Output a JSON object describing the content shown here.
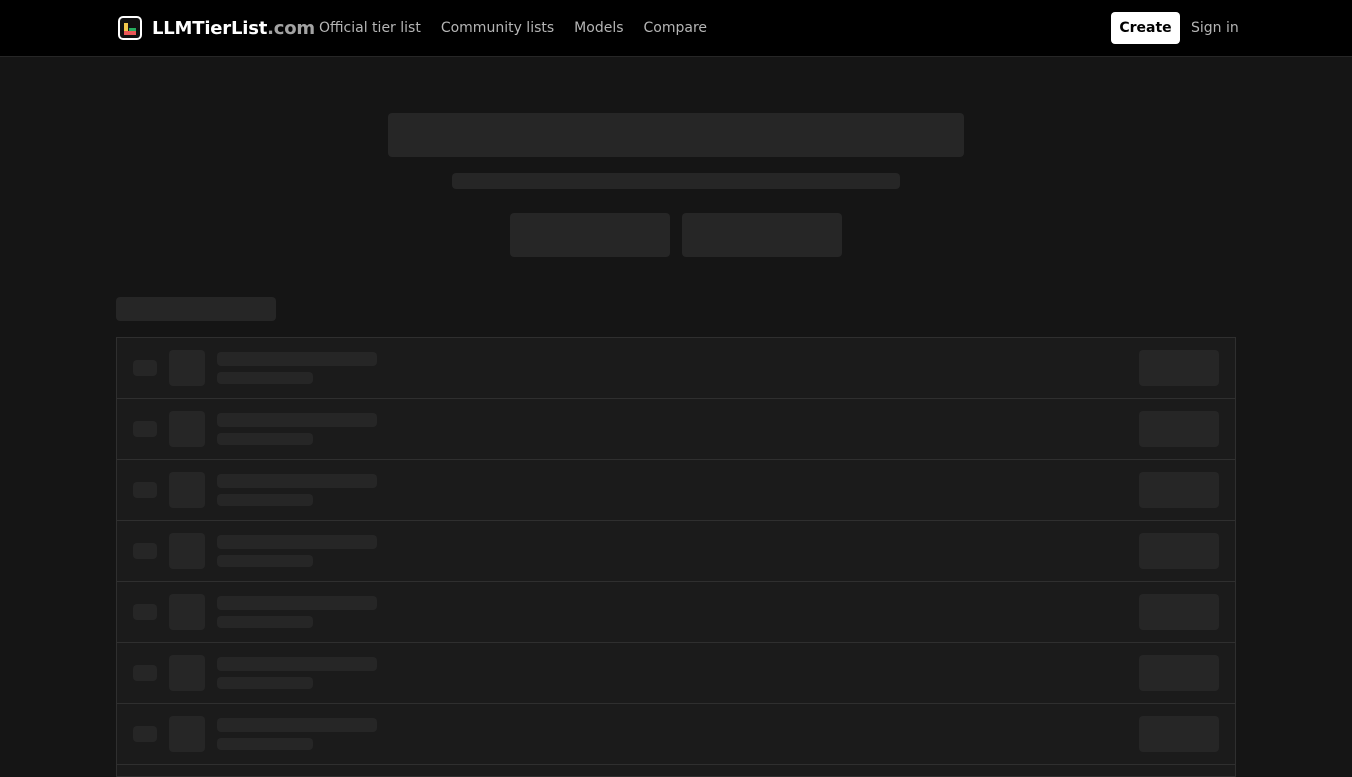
{
  "brand": {
    "name": "LLMTierList",
    "suffix": ".com"
  },
  "nav": {
    "items": [
      {
        "label": "Official tier list"
      },
      {
        "label": "Community lists"
      },
      {
        "label": "Models"
      },
      {
        "label": "Compare"
      }
    ]
  },
  "actions": {
    "create_label": "Create",
    "signin_label": "Sign in"
  },
  "loading_state": {
    "list_rows_visible": 7
  },
  "colors": {
    "background": "#151515",
    "topbar": "#000000",
    "skeleton": "#262626",
    "nav_text": "#b5b5b5",
    "create_button_bg": "#ffffff"
  },
  "icons": {
    "logo": "tier-chart-logo-icon"
  }
}
